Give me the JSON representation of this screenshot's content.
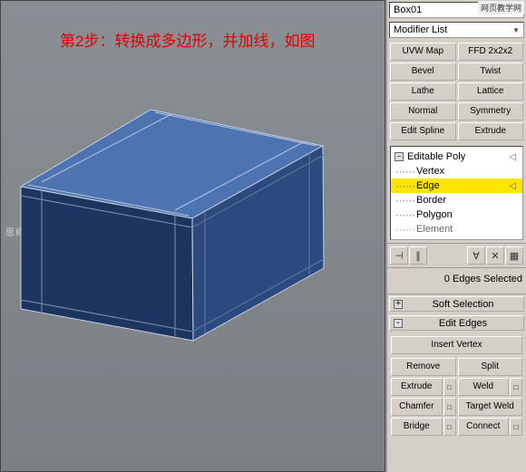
{
  "viewport": {
    "caption": "第2步：转换成多边形，并加线，如图",
    "watermark": "思缘设计论坛 - WWW.MISSYUAN.COM"
  },
  "logo": "网页教学网",
  "object_name": "Box01",
  "modifier_list_label": "Modifier List",
  "modifier_buttons": [
    "UVW Map",
    "FFD 2x2x2",
    "Bevel",
    "Twist",
    "Lathe",
    "Lattice",
    "Normal",
    "Symmetry",
    "Edit Spline",
    "Extrude"
  ],
  "stack": {
    "root": "Editable Poly",
    "children": [
      "Vertex",
      "Edge",
      "Border",
      "Polygon",
      "Element"
    ],
    "selected": "Edge"
  },
  "status_text": "0 Edges Selected",
  "rollups": {
    "soft_selection": {
      "sign": "+",
      "title": "Soft Selection"
    },
    "edit_edges": {
      "sign": "-",
      "title": "Edit Edges"
    }
  },
  "edit_edges": {
    "insert_vertex": "Insert Vertex",
    "row1": [
      "Remove",
      "Split"
    ],
    "row2": [
      "Extrude",
      "Weld"
    ],
    "row3": [
      "Chamfer",
      "Target Weld"
    ],
    "row4": [
      "Bridge",
      "Connect"
    ]
  }
}
